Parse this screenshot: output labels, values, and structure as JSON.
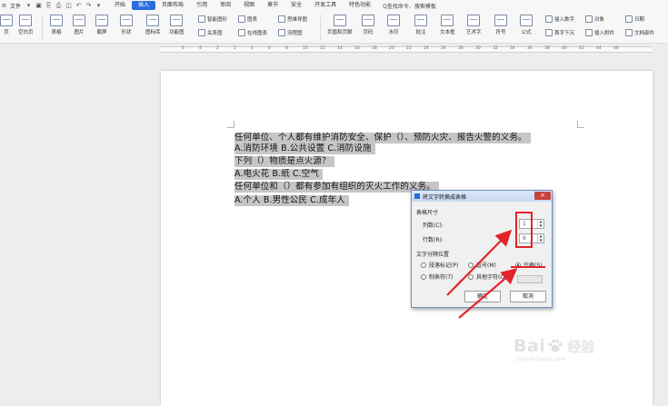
{
  "menubar": {
    "file_label": "文件",
    "tabs": [
      "开始",
      "插入",
      "页面布局",
      "引用",
      "审阅",
      "视图",
      "章节",
      "安全",
      "开发工具",
      "特色功能"
    ],
    "active_tab": "插入",
    "search_label": "Q查找命令、搜索模板"
  },
  "ribbon": {
    "big_buttons": [
      "页",
      "空白页",
      "表格",
      "图片",
      "截屏",
      "形状",
      "图标库",
      "功能图"
    ],
    "small_buttons": [
      "智能图形",
      "关系图",
      "图表",
      "在线图表",
      "思维导图",
      "流程图"
    ],
    "big_buttons_right": [
      "页眉和页脚",
      "页码",
      "水印",
      "批注",
      "文本框",
      "艺术字",
      "符号",
      "公式"
    ],
    "right_small": [
      "插入数字",
      "首字下沉",
      "对象",
      "插入附件",
      "日期",
      "文档部件"
    ]
  },
  "ruler": {
    "ticks": [
      "6",
      "4",
      "2",
      "2",
      "4",
      "6",
      "8",
      "10",
      "12",
      "14",
      "16",
      "18",
      "20",
      "22",
      "24",
      "26",
      "28",
      "30",
      "32",
      "34",
      "36",
      "38",
      "40",
      "42",
      "44",
      "46"
    ]
  },
  "document": {
    "lines": [
      "任何单位、个人都有维护消防安全、保护（）、预防火灾、报告火警的义务。",
      "A.消防环境   B.公共设置   C.消防设施",
      "下列（）物质是点火源？",
      "A.电火花   B.纸   C.空气",
      "任何单位和（）都有参加有组织的灭火工作的义务。",
      "A.个人   B.男性公民   C.成年人"
    ]
  },
  "dialog": {
    "title": "将文字转换成表格",
    "close_label": "×",
    "table_size_label": "表格尺寸",
    "columns_label": "列数(C):",
    "columns_value": "1",
    "rows_label": "行数(R):",
    "rows_value": "6",
    "separator_group_label": "文字分隔位置",
    "radios": [
      {
        "label": "段落标记(P)",
        "checked": false
      },
      {
        "label": "逗号(M)",
        "checked": false
      },
      {
        "label": "空格(S)",
        "checked": true
      },
      {
        "label": "制表符(T)",
        "checked": false
      },
      {
        "label": "其他字符(O):",
        "checked": false
      }
    ],
    "ok_label": "确定",
    "cancel_label": "取消"
  },
  "watermark": {
    "brand_left": "Bai",
    "brand_right": "经验",
    "url": "jingyan.baidu.com"
  },
  "colors": {
    "accent": "#2b6fdc",
    "annotation_red": "#e3232b",
    "selection_gray": "#c6c6c6"
  }
}
